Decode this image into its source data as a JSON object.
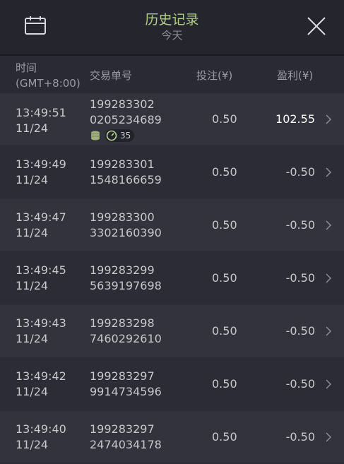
{
  "header": {
    "title": "历史记录",
    "subtitle": "今天",
    "calendar_icon": "calendar-icon",
    "close_icon": "close-icon"
  },
  "columns": {
    "time": "时间",
    "timezone": "(GMT+8:00)",
    "order": "交易单号",
    "bet": "投注(¥)",
    "profit": "盈利(¥)"
  },
  "rows": [
    {
      "time": "13:49:51",
      "date": "11/24",
      "order_line1": "199283302",
      "order_line2": "0205234689",
      "bet": "0.50",
      "profit": "102.55",
      "badge_count": "35"
    },
    {
      "time": "13:49:49",
      "date": "11/24",
      "order_line1": "199283301",
      "order_line2": "1548166659",
      "bet": "0.50",
      "profit": "-0.50"
    },
    {
      "time": "13:49:47",
      "date": "11/24",
      "order_line1": "199283300",
      "order_line2": "3302160390",
      "bet": "0.50",
      "profit": "-0.50"
    },
    {
      "time": "13:49:45",
      "date": "11/24",
      "order_line1": "199283299",
      "order_line2": "5639197698",
      "bet": "0.50",
      "profit": "-0.50"
    },
    {
      "time": "13:49:43",
      "date": "11/24",
      "order_line1": "199283298",
      "order_line2": "7460292610",
      "bet": "0.50",
      "profit": "-0.50"
    },
    {
      "time": "13:49:42",
      "date": "11/24",
      "order_line1": "199283297",
      "order_line2": "9914734596",
      "bet": "0.50",
      "profit": "-0.50"
    },
    {
      "time": "13:49:40",
      "date": "11/24",
      "order_line1": "199283297",
      "order_line2": "2474034178",
      "bet": "0.50",
      "profit": "-0.50"
    }
  ],
  "colors": {
    "title": "#b4d08a",
    "background": "#2c2d36",
    "win": "#ffffff"
  }
}
